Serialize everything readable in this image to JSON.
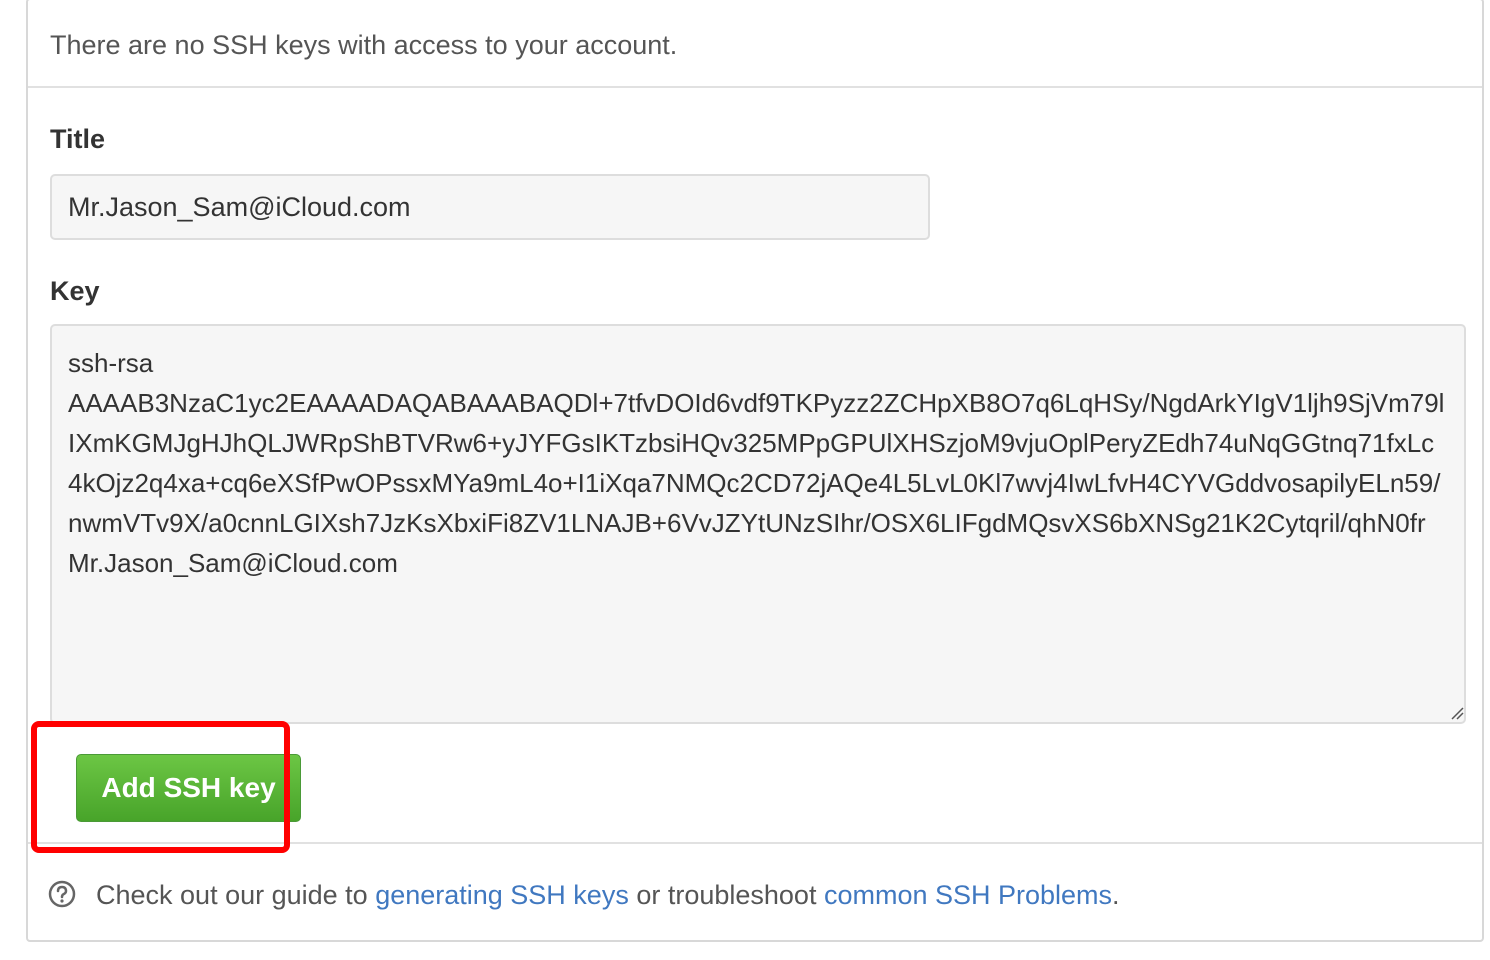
{
  "no_keys": {
    "message": "There are no SSH keys with access to your account."
  },
  "form": {
    "title_label": "Title",
    "title_value": "Mr.Jason_Sam@iCloud.com",
    "key_label": "Key",
    "key_value": "ssh-rsa\nAAAAB3NzaC1yc2EAAAADAQABAAABAQDl+7tfvDOId6vdf9TKPyzz2ZCHpXB8O7q6LqHSy/NgdArkYIgV1ljh9SjVm79lIXmKGMJgHJhQLJWRpShBTVRw6+yJYFGsIKTzbsiHQv325MPpGPUlXHSzjoM9vjuOplPeryZEdh74uNqGGtnq71fxLc4kOjz2q4xa+cq6eXSfPwOPssxMYa9mL4o+I1iXqa7NMQc2CD72jAQe4L5LvL0Kl7wvj4IwLfvH4CYVGddvosapilyELn59/nwmVTv9X/a0cnnLGIXsh7JzKsXbxiFi8ZV1LNAJB+6VvJZYtUNzSIhr/OSX6LIFgdMQsvXS6bXNSg21K2Cytqril/qhN0fr Mr.Jason_Sam@iCloud.com",
    "submit_label": "Add SSH key"
  },
  "footer": {
    "icon": "question-circle-icon",
    "prefix": "Check out our guide to ",
    "link1": "generating SSH keys",
    "middle": " or troubleshoot ",
    "link2": "common SSH Problems",
    "suffix": "."
  },
  "colors": {
    "button_green": "#6cc644",
    "highlight_red": "#ff0000",
    "link_blue": "#4078c0"
  }
}
